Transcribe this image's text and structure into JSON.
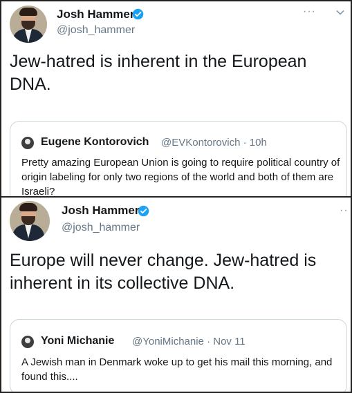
{
  "tweets": [
    {
      "author": {
        "name": "Josh Hammer",
        "handle": "@josh_hammer"
      },
      "text": "Jew-hatred is inherent in the European DNA.",
      "menu": "···",
      "quote": {
        "name": "Eugene Kontorovich",
        "meta": "@EVKontorovich · 10h",
        "text": "Pretty amazing European Union is going to require political  country of origin labeling for only two regions of the world and both of them are Israeli?"
      }
    },
    {
      "author": {
        "name": "Josh Hammer",
        "handle": "@josh_hammer"
      },
      "text": "Europe will never change. Jew-hatred is inherent in its collective DNA.",
      "menu": "··",
      "quote": {
        "name": "Yoni Michanie",
        "meta": "@YoniMichanie · Nov 11",
        "text": "A Jewish man in Denmark woke up to get his mail this morning, and found this...."
      }
    }
  ],
  "colors": {
    "verified": "#1da1f2",
    "handle": "#657786",
    "text": "#14171a",
    "border": "#ccd6dd"
  },
  "icons": [
    "verified-badge-icon",
    "more-options-icon",
    "chevron-down-icon"
  ]
}
